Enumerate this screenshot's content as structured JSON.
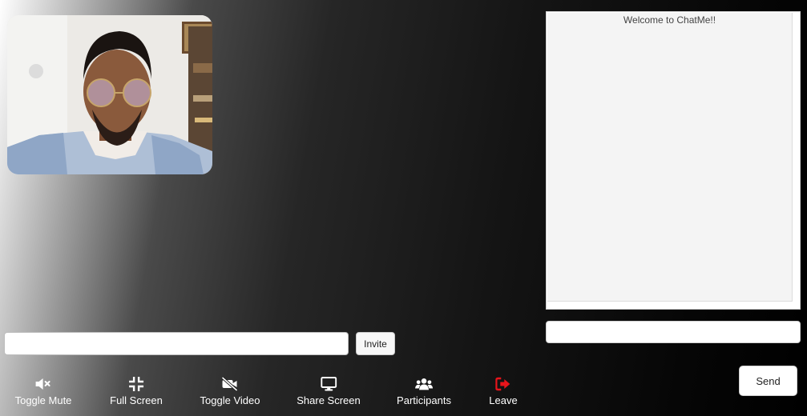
{
  "video": {
    "participant": "local-user"
  },
  "invite": {
    "value": "",
    "placeholder": "",
    "button_label": "Invite"
  },
  "controls": [
    {
      "label": "Toggle Mute",
      "icon": "volume-mute-icon",
      "color": "#ffffff"
    },
    {
      "label": "Full Screen",
      "icon": "compress-icon",
      "color": "#ffffff"
    },
    {
      "label": "Toggle Video",
      "icon": "video-off-icon",
      "color": "#ffffff"
    },
    {
      "label": "Share Screen",
      "icon": "desktop-icon",
      "color": "#ffffff"
    },
    {
      "label": "Participants",
      "icon": "users-icon",
      "color": "#ffffff"
    },
    {
      "label": "Leave",
      "icon": "sign-out-icon",
      "color": "#e8141b"
    }
  ],
  "chat": {
    "welcome": "Welcome to ChatMe!!",
    "input_value": "",
    "input_placeholder": "",
    "send_label": "Send"
  }
}
